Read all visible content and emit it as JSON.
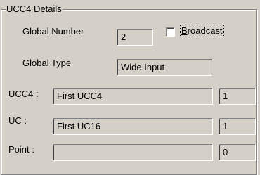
{
  "group": {
    "title": "UCC4 Details"
  },
  "global_number": {
    "label": "Global Number",
    "value": "2"
  },
  "broadcast": {
    "access_key": "B",
    "label_rest": "roadcast",
    "checked": false
  },
  "global_type": {
    "label": "Global Type",
    "value": "Wide Input"
  },
  "ucc4": {
    "label": "UCC4 :",
    "name": "First UCC4",
    "number": "1"
  },
  "uc": {
    "label": "UC :",
    "name": "First UC16",
    "number": "1"
  },
  "point": {
    "label": "Point :",
    "name": "",
    "number": "0"
  }
}
